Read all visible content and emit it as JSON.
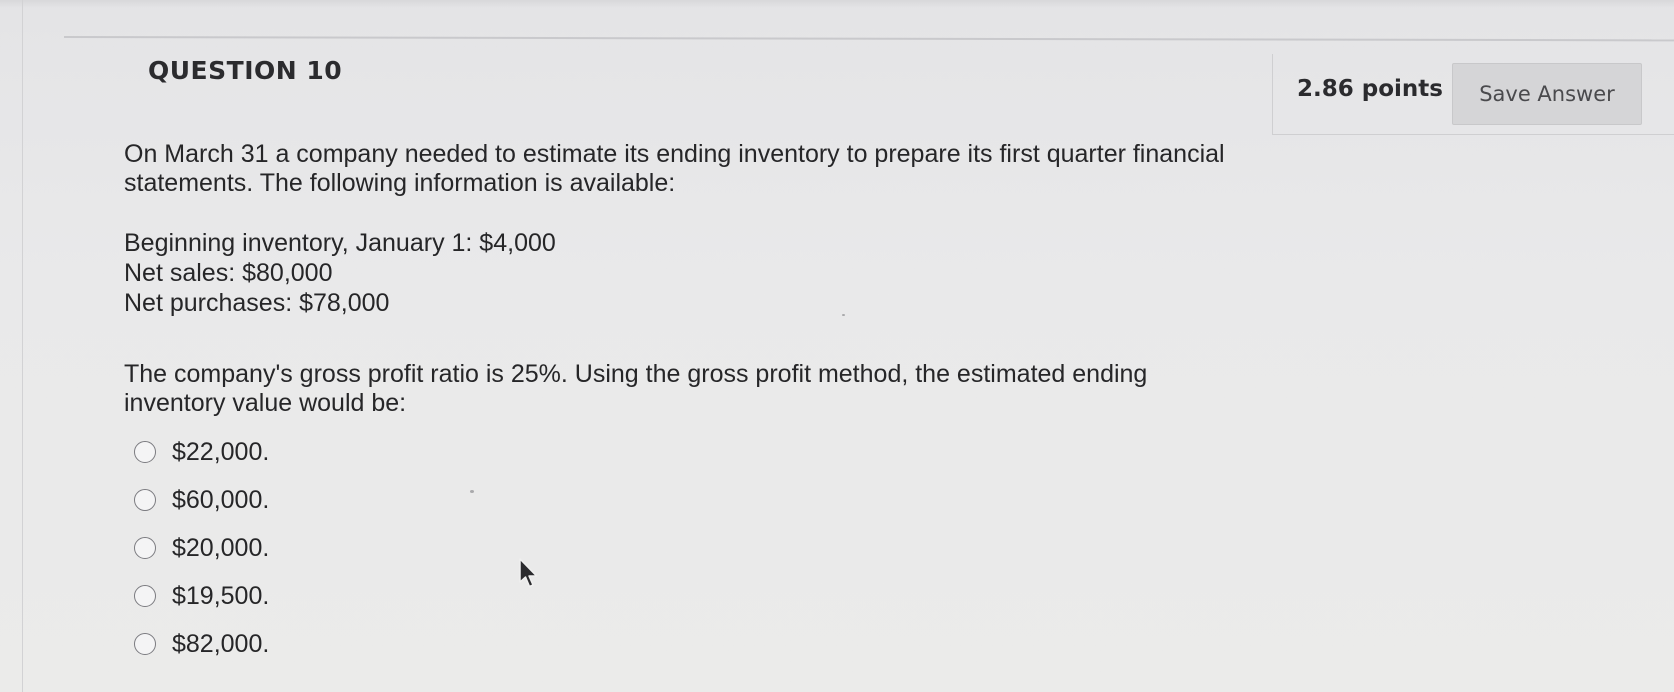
{
  "question": {
    "title": "QUESTION 10",
    "points": "2.86 points",
    "save_label": "Save Answer",
    "intro_lines": [
      "On March 31 a company needed to estimate its ending inventory to prepare its first quarter financial",
      "statements. The following information is available:"
    ],
    "facts": [
      "Beginning inventory, January 1: $4,000",
      "Net sales: $80,000",
      "Net purchases: $78,000"
    ],
    "prompt_lines": [
      "The company's gross profit ratio is 25%. Using the gross profit method, the estimated ending",
      "inventory value would be:"
    ],
    "options": [
      "$22,000.",
      "$60,000.",
      "$20,000.",
      "$19,500.",
      "$82,000."
    ]
  }
}
